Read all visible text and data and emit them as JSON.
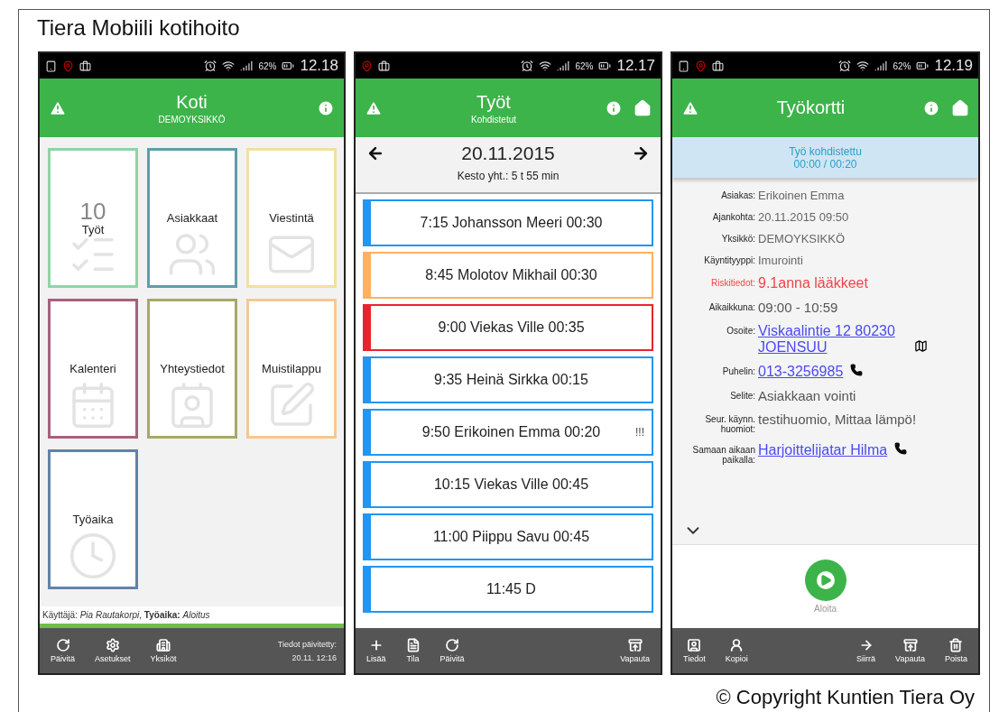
{
  "title": "Tiera Mobiili kotihoito",
  "screens": [
    {
      "kind": "home",
      "status": {
        "battery": "62%",
        "time": "12.18"
      },
      "header": {
        "title": "Koti",
        "subtitle": "DEMOYKSIKKÖ",
        "home_button": false
      },
      "tiles": [
        {
          "kind": "jobs",
          "label": "Työt",
          "count": "10",
          "color": "#8fd4a8"
        },
        {
          "kind": "customers",
          "label": "Asiakkaat",
          "color": "#5f9ea8"
        },
        {
          "kind": "messages",
          "label": "Viestintä",
          "color": "#f3dfa0"
        },
        {
          "kind": "calendar",
          "label": "Kalenteri",
          "color": "#a8607e"
        },
        {
          "kind": "contacts",
          "label": "Yhteystiedot",
          "color": "#a8a866"
        },
        {
          "kind": "notes",
          "label": "Muistilappu",
          "color": "#f7c891"
        },
        {
          "kind": "worktime",
          "label": "Työaika",
          "color": "#6382aa"
        }
      ],
      "user_line": "Käyttäjä: *Pia Rautakorpi*, **Työaika:** *Aloitus*",
      "toolbar_left": [
        {
          "kind": "refresh",
          "label": "Päivitä"
        },
        {
          "kind": "settings",
          "label": "Asetukset"
        },
        {
          "kind": "units",
          "label": "Yksiköt"
        }
      ],
      "updated": [
        "Tiedot päivitetty:",
        "20.11. 12:16"
      ]
    },
    {
      "kind": "jobs",
      "status": {
        "battery": "62%",
        "time": "12.17"
      },
      "header": {
        "title": "Työt",
        "subtitle": "Kohdistetut",
        "home_button": true
      },
      "date": "20.11.2015",
      "duration": "Kesto yht.: 5 t 55 min",
      "jobs": [
        {
          "text": "7:15 Johansson Meeri 00:30",
          "color": "#2196f3"
        },
        {
          "text": "8:45 Molotov Mikhail 00:30",
          "color": "#ffb060"
        },
        {
          "text": "9:00 Viekas Ville 00:35",
          "color": "#e8242b"
        },
        {
          "text": "9:35 Heinä Sirkka 00:15",
          "color": "#2196f3"
        },
        {
          "text": "9:50 Erikoinen Emma 00:20",
          "color": "#2196f3",
          "flag": "!!!"
        },
        {
          "text": "10:15 Viekas Ville 00:45",
          "color": "#2196f3"
        },
        {
          "text": "11:00 Piippu Savu 00:45",
          "color": "#2196f3"
        },
        {
          "text": "11:45 D",
          "color": "#2196f3"
        }
      ],
      "toolbar_left": [
        {
          "kind": "add",
          "label": "Lisää"
        },
        {
          "kind": "state",
          "label": "Tila"
        },
        {
          "kind": "refresh",
          "label": "Päivitä"
        }
      ],
      "toolbar_right": [
        {
          "kind": "release",
          "label": "Vapauta"
        }
      ]
    },
    {
      "kind": "card",
      "status": {
        "battery": "62%",
        "time": "12.19"
      },
      "header": {
        "title": "Työkortti",
        "home_button": true
      },
      "banner": [
        "Työ kohdistettu",
        "00:00 / 00:20"
      ],
      "fields": [
        {
          "label": "Asiakas:",
          "value": "Erikoinen Emma",
          "kind": "plain"
        },
        {
          "label": "Ajankohta:",
          "value": "20.11.2015 09:50",
          "kind": "plain"
        },
        {
          "label": "Yksikkö:",
          "value": "DEMOYKSIKKÖ",
          "kind": "plain"
        },
        {
          "label": "Käyntityyppi:",
          "value": "Imurointi",
          "kind": "plain"
        },
        {
          "label": "Riskitiedot:",
          "value": "9.1anna lääkkeet",
          "kind": "risk"
        },
        {
          "label": "Aikaikkuna:",
          "value": "09:00 - 10:59",
          "kind": "large"
        },
        {
          "label": "Osoite:",
          "value": "Viskaalintie 12 80230 JOENSUU",
          "kind": "address"
        },
        {
          "label": "Puhelin:",
          "value": "013-3256985",
          "kind": "phone"
        },
        {
          "label": "Selite:",
          "value": "Asiakkaan vointi",
          "kind": "large"
        },
        {
          "label": "Seur. käynn. huomiot:",
          "value": "testihuomio, Mittaa lämpö!",
          "kind": "large"
        },
        {
          "label": "Samaan aikaan paikalla:",
          "value": "Harjoittelijatar Hilma",
          "kind": "phone"
        }
      ],
      "start_label": "Aloita",
      "toolbar_left": [
        {
          "kind": "info",
          "label": "Tiedot"
        },
        {
          "kind": "copy",
          "label": "Kopioi"
        }
      ],
      "toolbar_right": [
        {
          "kind": "move",
          "label": "Siirrä"
        },
        {
          "kind": "release",
          "label": "Vapauta"
        },
        {
          "kind": "delete",
          "label": "Poista"
        }
      ]
    }
  ],
  "copyright": "© Copyright Kuntien Tiera Oy"
}
